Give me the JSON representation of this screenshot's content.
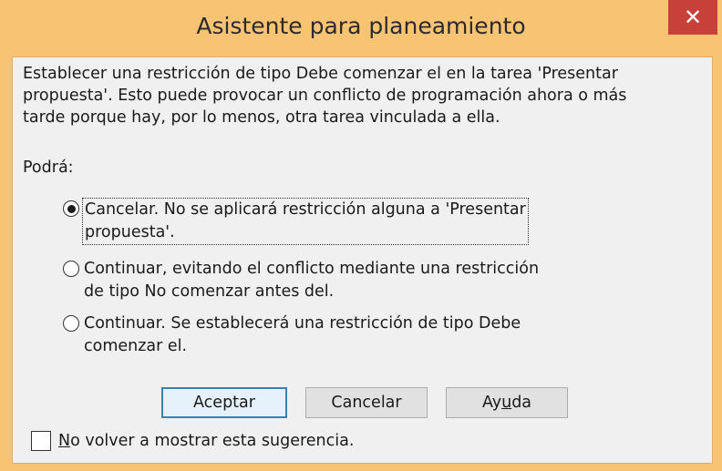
{
  "window": {
    "title": "Asistente para planeamiento",
    "close_glyph": "✕"
  },
  "message": "Establecer una restricción de tipo Debe comenzar el en la tarea 'Presentar\npropuesta'. Esto puede provocar un conflicto de programación ahora o más\ntarde porque hay, por lo menos, otra tarea vinculada a ella.",
  "prompt": "Podrá:",
  "options": [
    {
      "label": "Cancelar. No se aplicará restricción alguna a 'Presentar\npropuesta'.",
      "selected": true
    },
    {
      "label": "Continuar, evitando el conflicto mediante una restricción\nde tipo No comenzar antes del.",
      "selected": false
    },
    {
      "label": "Continuar. Se establecerá una restricción de tipo Debe\ncomenzar el.",
      "selected": false
    }
  ],
  "buttons": {
    "ok": "Aceptar",
    "cancel": "Cancelar",
    "help_before": "Ay",
    "help_mnemonic": "u",
    "help_after": "da"
  },
  "dont_show": {
    "mnemonic": "N",
    "rest": "o volver a mostrar esta sugerencia.",
    "checked": false
  },
  "colors": {
    "titlebar": "#f8c473",
    "close_button": "#c7403a",
    "client_bg": "#f0f0f0",
    "default_button_border": "#3c7fb1"
  }
}
